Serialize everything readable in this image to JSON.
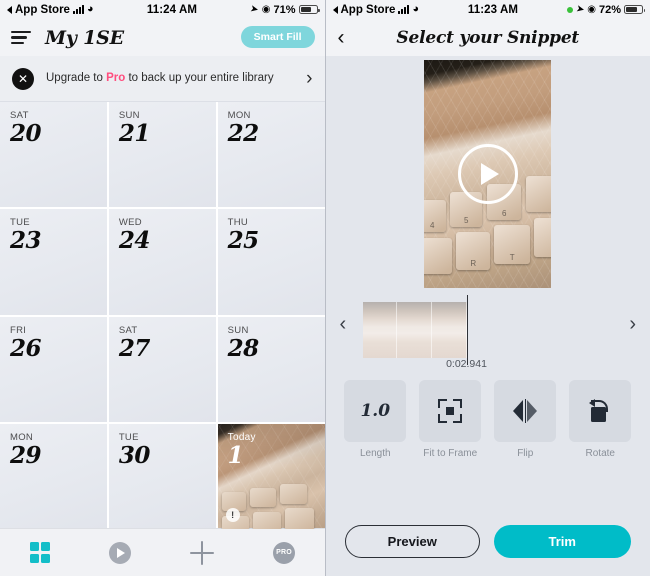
{
  "left": {
    "status_bar": {
      "back_app": "App Store",
      "time": "11:24 AM",
      "battery_pct": "71%",
      "signal_icon": "cellular-bars-icon",
      "wifi_icon": "wifi-icon",
      "location_icon": "location-arrow-icon",
      "alarm_icon": "alarm-icon",
      "battery_icon": "battery-icon"
    },
    "nav": {
      "menu_icon": "hamburger-menu-icon",
      "title": "My 1SE",
      "smart_fill_label": "Smart Fill",
      "smart_fill_color": "#7fd6dc"
    },
    "banner": {
      "close_icon": "close-x-icon",
      "text_before": "Upgrade to ",
      "text_highlight": "Pro",
      "text_after": " to back up your entire library",
      "highlight_color": "#ff4d7e",
      "chevron_icon": "chevron-right-icon"
    },
    "calendar": {
      "days": [
        {
          "dow": "SAT",
          "num": "20"
        },
        {
          "dow": "SUN",
          "num": "21"
        },
        {
          "dow": "MON",
          "num": "22"
        },
        {
          "dow": "TUE",
          "num": "23"
        },
        {
          "dow": "WED",
          "num": "24"
        },
        {
          "dow": "THU",
          "num": "25"
        },
        {
          "dow": "FRI",
          "num": "26"
        },
        {
          "dow": "SAT",
          "num": "27"
        },
        {
          "dow": "SUN",
          "num": "28"
        },
        {
          "dow": "MON",
          "num": "29"
        },
        {
          "dow": "TUE",
          "num": "30"
        }
      ],
      "today": {
        "dow": "Today",
        "num": "1",
        "badge": "!"
      }
    },
    "tabbar": {
      "items": [
        {
          "name": "grid-icon",
          "label": "",
          "active": true,
          "color": "#13bec8"
        },
        {
          "name": "play-circle-icon",
          "label": "",
          "active": false,
          "color": "#a6abb4"
        },
        {
          "name": "plus-icon",
          "label": "",
          "active": false,
          "color": "#8e949e"
        },
        {
          "name": "pro-badge-icon",
          "label": "PRO",
          "active": false,
          "color": "#9aa0aa"
        }
      ]
    }
  },
  "right": {
    "status_bar": {
      "back_app": "App Store",
      "time": "11:23 AM",
      "battery_pct": "72%",
      "recording_dot_color": "#3ac13a",
      "signal_icon": "cellular-bars-icon",
      "wifi_icon": "wifi-icon",
      "location_icon": "location-arrow-icon",
      "alarm_icon": "alarm-icon",
      "battery_icon": "battery-icon"
    },
    "nav": {
      "back_icon": "chevron-left-icon",
      "title": "Select your Snippet"
    },
    "video": {
      "play_icon": "play-button-icon",
      "keys": [
        "%",
        "5",
        "4",
        "6",
        "R",
        "T"
      ]
    },
    "timeline": {
      "prev_icon": "chevron-left-icon",
      "next_icon": "chevron-right-icon",
      "timestamp": "0:02.941",
      "frame_count": 3
    },
    "tools": [
      {
        "label": "Length",
        "icon": "length-1.0-icon",
        "value": "1.0"
      },
      {
        "label": "Fit to Frame",
        "icon": "fit-to-frame-icon",
        "value": ""
      },
      {
        "label": "Flip",
        "icon": "flip-horizontal-icon",
        "value": ""
      },
      {
        "label": "Rotate",
        "icon": "rotate-icon",
        "value": ""
      }
    ],
    "actions": {
      "preview_label": "Preview",
      "trim_label": "Trim",
      "trim_color": "#00bcc8"
    }
  }
}
